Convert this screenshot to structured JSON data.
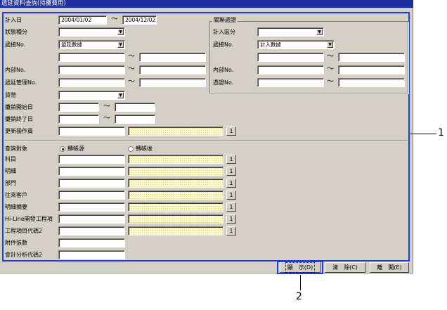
{
  "window": {
    "title": "遞延資料查詢(持攤費用)"
  },
  "left": {
    "date_label": "計入日",
    "date_from": "2004/01/02",
    "date_to": "2004/12/02",
    "status_label": "狀態種分",
    "status_value": "",
    "transfer_label": "遞接No.",
    "transfer_value": "遞延數據",
    "internal_label": "內部No.",
    "mgmt_label": "遞延管理No.",
    "currency_label": "貨幣",
    "currency_value": "",
    "start_label": "攤銷開始日",
    "end_label": "攤銷終了日",
    "updater_label": "更新操作員"
  },
  "related": {
    "group_title": "關聯遞證",
    "category_label": "計入區分",
    "category_value": "",
    "transfer_label": "遞接No.",
    "transfer_value": "計入數據",
    "internal_label": "內部No.",
    "slip_label": "憑證No."
  },
  "lower": {
    "target_label": "查詢對象",
    "radio_before": "轉帳源",
    "radio_after": "轉帳後",
    "rows": [
      {
        "label": "科目",
        "btn": "1"
      },
      {
        "label": "明細",
        "btn": "1"
      },
      {
        "label": "部門",
        "btn": "1"
      },
      {
        "label": "往來客戶",
        "btn": "1"
      },
      {
        "label": "明細摘要",
        "btn": "1"
      },
      {
        "label": "Hi-Line開發工程項",
        "btn": "1"
      },
      {
        "label": "工程項目代碼2",
        "btn": "1"
      }
    ],
    "attach_label": "附件張數",
    "acct_label": "會計分析代碼2",
    "updater_btn": "1"
  },
  "tilde": "～",
  "buttons": {
    "display": "顯　示(D)",
    "clear": "清　除(C)",
    "close": "離　開(E)"
  },
  "callouts": {
    "one": "1",
    "two": "2"
  },
  "colors": {
    "titlebar": "#1c2f9a",
    "highlight": "#1e3cdc",
    "face": "#d4d0c8"
  }
}
